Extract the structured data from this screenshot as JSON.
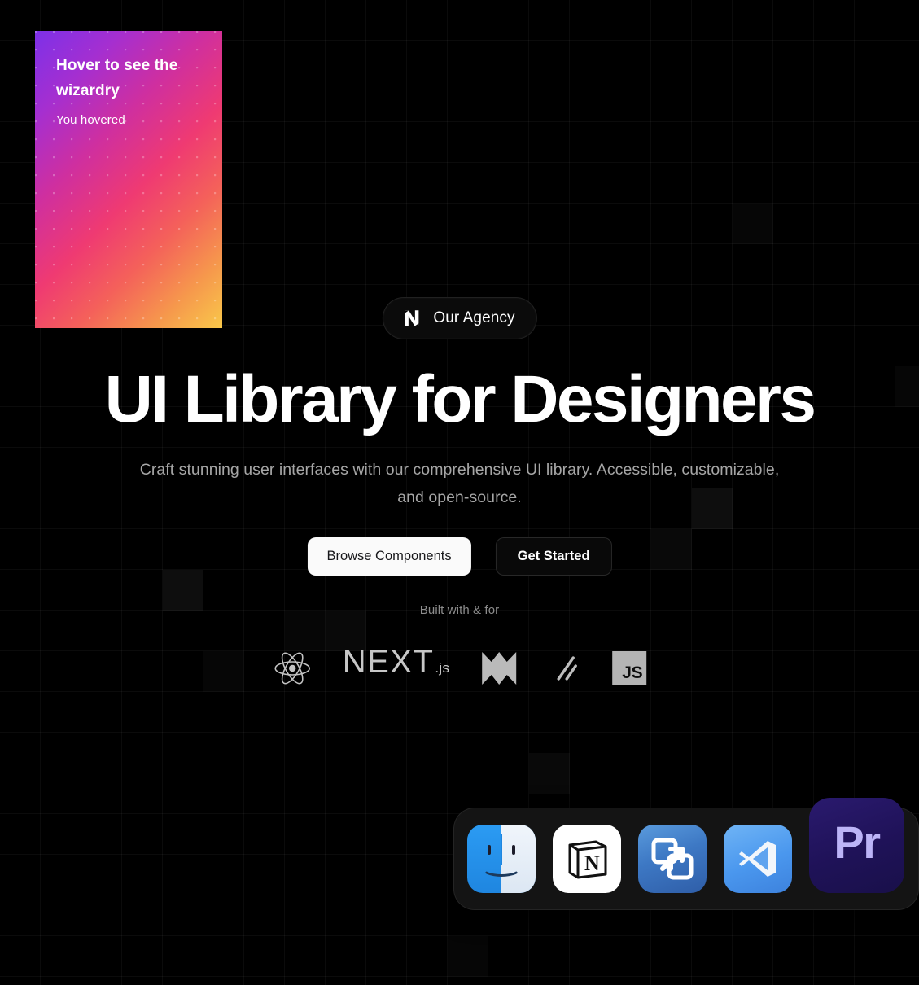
{
  "page": {
    "background_color": "#000000",
    "grid_color": "#1a1a1a"
  },
  "wizard_card": {
    "title": "Hover to see the wizardry",
    "status": "You hovered",
    "gradient_from": "#7d30e8",
    "gradient_mid": "#ef3a72",
    "gradient_to": "#f9c84a"
  },
  "hero": {
    "badge": {
      "icon": "angular-n-logo-icon",
      "label": "Our Agency"
    },
    "headline": "UI Library for Designers",
    "subhead": "Craft stunning user interfaces with our comprehensive UI library. Accessible, customizable, and open-source.",
    "cta": {
      "primary_label": "Browse Components",
      "secondary_label": "Get Started"
    },
    "built_with_label": "Built with & for",
    "tech_logos": [
      {
        "name": "react-logo-icon",
        "label": "React"
      },
      {
        "name": "nextjs-logo-icon",
        "label": "NEXT",
        "suffix": ".js"
      },
      {
        "name": "motion-logo-icon",
        "label": "Motion"
      },
      {
        "name": "slashes-logo-icon",
        "label": "Tailwind"
      },
      {
        "name": "javascript-logo-icon",
        "label": "JS"
      }
    ]
  },
  "dock": {
    "items": [
      {
        "name": "dock-item-finder",
        "label": "Finder",
        "magnified": false
      },
      {
        "name": "dock-item-notion",
        "label": "Notion",
        "magnified": false
      },
      {
        "name": "dock-item-fusion",
        "label": "VMware Fusion",
        "magnified": false
      },
      {
        "name": "dock-item-vscode",
        "label": "Visual Studio Code",
        "magnified": false
      },
      {
        "name": "dock-item-premiere",
        "label": "Pr",
        "magnified": true
      }
    ]
  }
}
